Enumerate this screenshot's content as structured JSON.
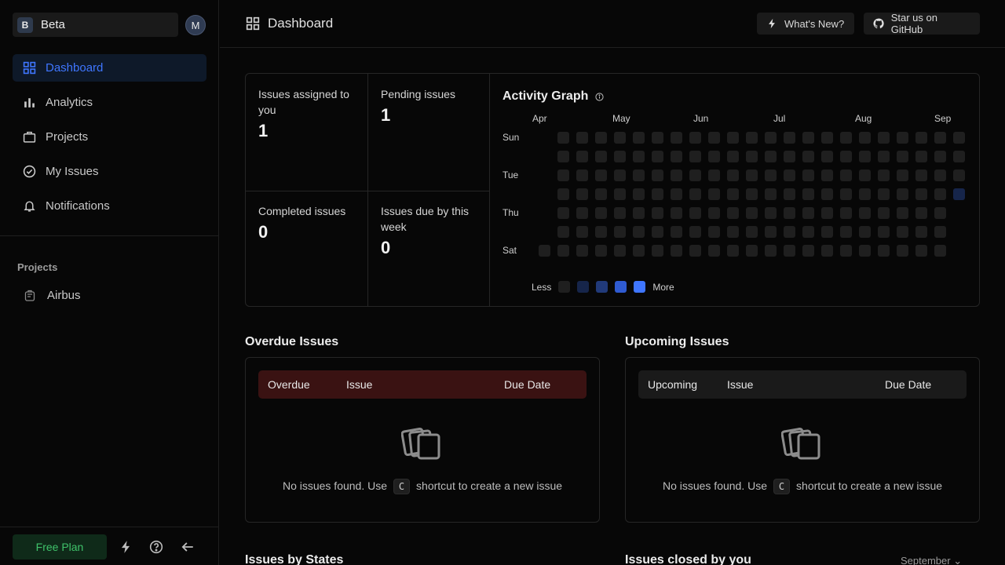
{
  "workspace": {
    "initial": "B",
    "name": "Beta",
    "user_initial": "M"
  },
  "nav": [
    {
      "label": "Dashboard",
      "icon": "grid-icon",
      "active": true
    },
    {
      "label": "Analytics",
      "icon": "bar-chart-icon",
      "active": false
    },
    {
      "label": "Projects",
      "icon": "briefcase-icon",
      "active": false
    },
    {
      "label": "My Issues",
      "icon": "check-circle-icon",
      "active": false
    },
    {
      "label": "Notifications",
      "icon": "bell-icon",
      "active": false
    }
  ],
  "projects": {
    "heading": "Projects",
    "items": [
      {
        "name": "Airbus",
        "icon": "project-icon"
      }
    ]
  },
  "sidebar_bottom": {
    "plan_label": "Free Plan",
    "icons": [
      "lightning-icon",
      "help-icon",
      "arrow-left-icon"
    ]
  },
  "header": {
    "title": "Dashboard",
    "whats_new": "What's New?",
    "github": "Star us on GitHub"
  },
  "stats": [
    {
      "label": "Issues assigned to you",
      "value": "1"
    },
    {
      "label": "Pending issues",
      "value": "1"
    },
    {
      "label": "Completed issues",
      "value": "0"
    },
    {
      "label": "Issues due by this week",
      "value": "0"
    }
  ],
  "activity": {
    "title": "Activity Graph",
    "months": [
      "Apr",
      "May",
      "Jun",
      "Jul",
      "Aug",
      "Sep"
    ],
    "days": [
      "Sun",
      "Tue",
      "Thu",
      "Sat"
    ],
    "legend_less": "Less",
    "legend_more": "More",
    "colors": [
      "#1f1f1f",
      "#16254a",
      "#213a7a",
      "#2f5bd1",
      "#3f76ff"
    ],
    "highlight": {
      "week": 22,
      "day": 3,
      "level": 1
    }
  },
  "overdue": {
    "title": "Overdue Issues",
    "columns": [
      "Overdue",
      "Issue",
      "Due Date"
    ],
    "empty_prefix": "No issues found. Use",
    "shortcut": "C",
    "empty_suffix": "shortcut to create a new issue"
  },
  "upcoming": {
    "title": "Upcoming Issues",
    "columns": [
      "Upcoming",
      "Issue",
      "Due Date"
    ],
    "empty_prefix": "No issues found. Use",
    "shortcut": "C",
    "empty_suffix": "shortcut to create a new issue"
  },
  "bottom": {
    "states_title": "Issues by States",
    "closed_title": "Issues closed by you",
    "month_select": "September"
  }
}
